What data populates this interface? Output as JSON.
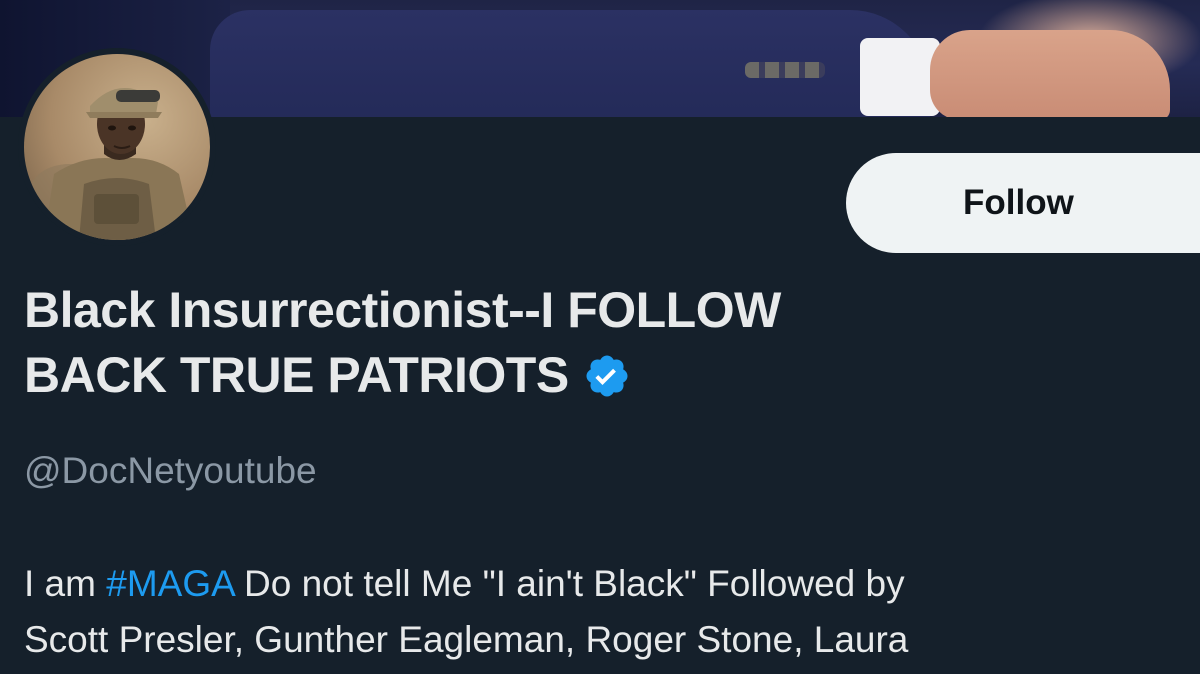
{
  "profile": {
    "display_name_line1": "Black Insurrectionist--I FOLLOW",
    "display_name_line2": "BACK TRUE PATRIOTS",
    "handle": "@DocNetyoutube",
    "follow_label": "Follow",
    "verified": true,
    "bio": {
      "prefix": "I am ",
      "hashtag": "#MAGA",
      "line1_rest": " Do not tell Me \"I ain't Black\" Followed by",
      "line2": "Scott Presler, Gunther Eagleman, Roger Stone, Laura"
    }
  },
  "colors": {
    "background": "#15202b",
    "text_primary": "#e7e9ea",
    "text_secondary": "#8b98a5",
    "accent": "#1d9bf0",
    "follow_button_bg": "#eff3f4"
  },
  "icons": {
    "verified": "verified-badge-icon"
  }
}
